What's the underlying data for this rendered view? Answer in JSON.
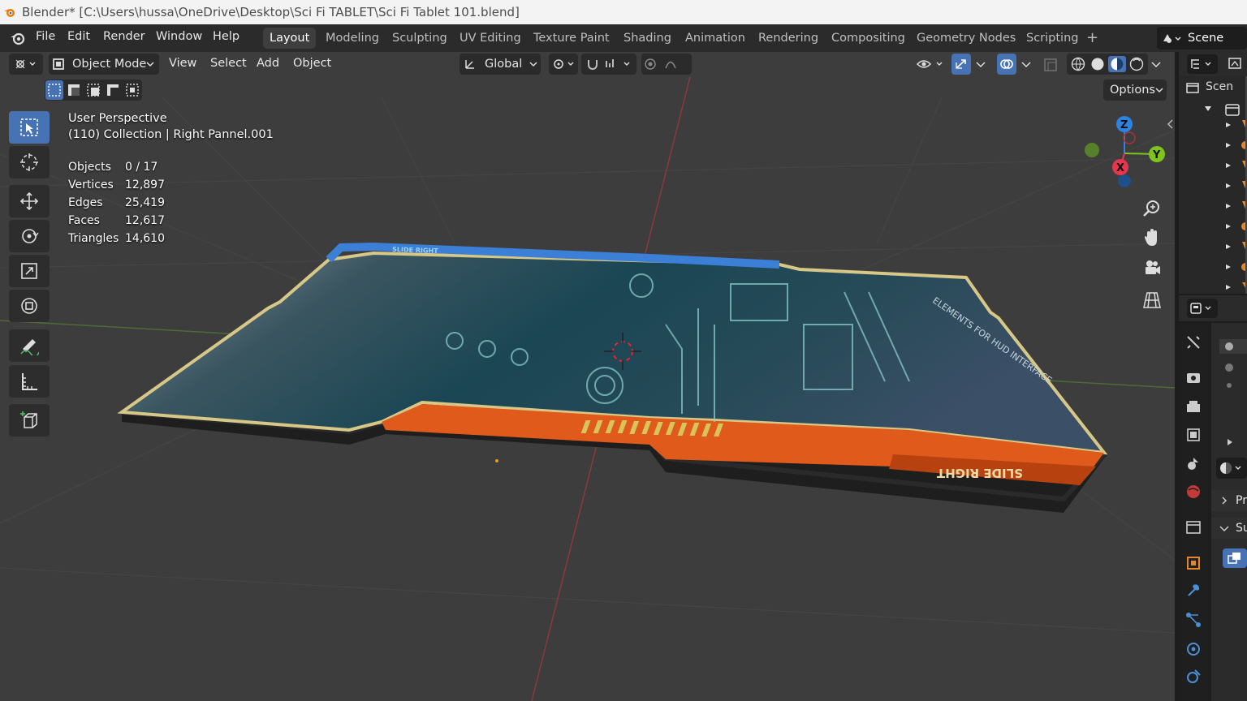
{
  "window": {
    "title": "Blender* [C:\\Users\\hussa\\OneDrive\\Desktop\\Sci Fi TABLET\\Sci Fi Tablet 101.blend]"
  },
  "menu": [
    "File",
    "Edit",
    "Render",
    "Window",
    "Help"
  ],
  "workspaces": [
    "Layout",
    "Modeling",
    "Sculpting",
    "UV Editing",
    "Texture Paint",
    "Shading",
    "Animation",
    "Rendering",
    "Compositing",
    "Geometry Nodes",
    "Scripting"
  ],
  "active_workspace": "Layout",
  "scene": {
    "label": "Scene"
  },
  "viewport_header": {
    "mode": "Object Mode",
    "menus": [
      "View",
      "Select",
      "Add",
      "Object"
    ],
    "orientation": "Global",
    "options_label": "Options"
  },
  "overlay": {
    "view_name": "User Perspective",
    "collection_info": "(110) Collection | Right Pannel.001",
    "stats": [
      {
        "label": "Objects",
        "value": "0 / 17"
      },
      {
        "label": "Vertices",
        "value": "12,897"
      },
      {
        "label": "Edges",
        "value": "25,419"
      },
      {
        "label": "Faces",
        "value": "12,617"
      },
      {
        "label": "Triangles",
        "value": "14,610"
      }
    ]
  },
  "model_text": {
    "front_label": "SLIDE RIGHT",
    "back_label": "SLIDE RIGHT",
    "side_label": "ELEMENTS FOR HUD INTERFACE"
  },
  "gizmo": {
    "z": "Z",
    "y": "Y",
    "x": "X"
  },
  "outliner": {
    "header": "Scen",
    "items_count": 8
  },
  "properties": {
    "panel1": "Pr",
    "panel2": "Su"
  },
  "colors": {
    "accent_blue": "#4772b3",
    "axis_x": "#e8364e",
    "axis_y": "#7fc31f",
    "axis_z": "#2f83e0",
    "tablet_orange": "#e05a1b",
    "tablet_blue": "#3b7fd6",
    "tablet_gold": "#c9b46e",
    "screen_teal": "#1d4d5a"
  }
}
